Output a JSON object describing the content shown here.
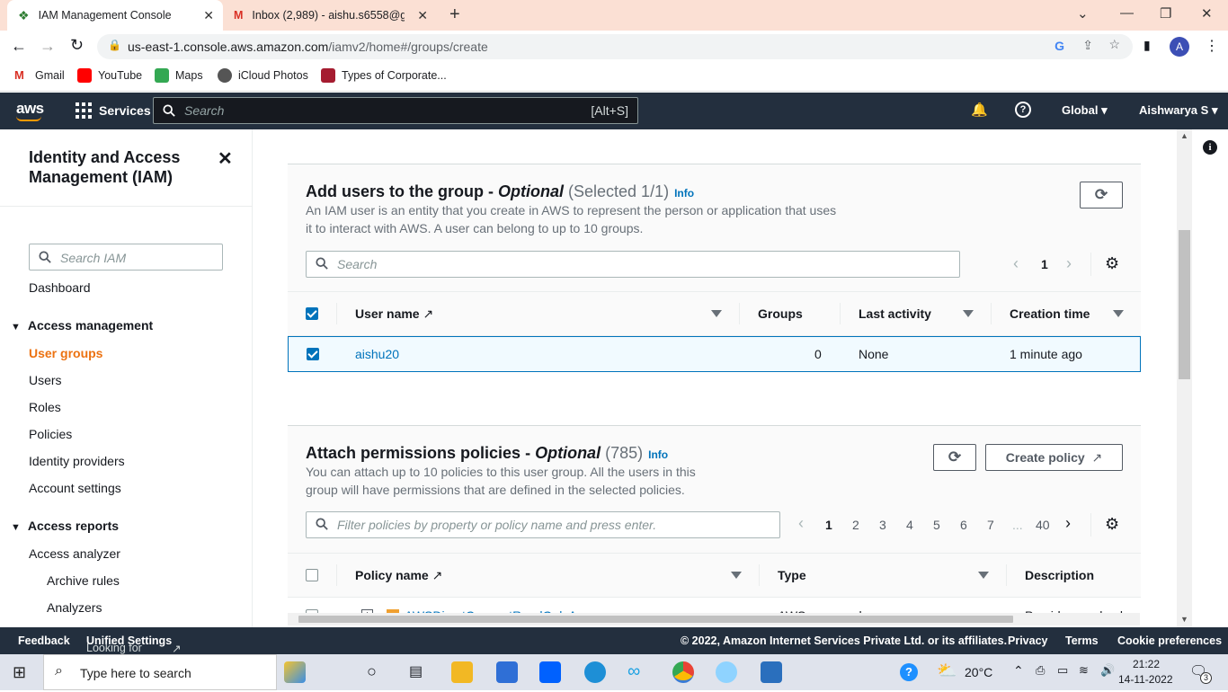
{
  "browser": {
    "tabs": [
      {
        "title": "IAM Management Console",
        "active": true
      },
      {
        "title": "Inbox (2,989) - aishu.s6558@gma",
        "active": false
      }
    ],
    "url_host": "us-east-1.console.aws.amazon.com",
    "url_path": "/iamv2/home#/groups/create",
    "profile_initial": "A",
    "bookmarks": [
      "Gmail",
      "YouTube",
      "Maps",
      "iCloud Photos",
      "Types of Corporate..."
    ]
  },
  "aws_header": {
    "logo": "aws",
    "services": "Services",
    "search_placeholder": "Search",
    "search_shortcut": "[Alt+S]",
    "region": "Global",
    "user": "Aishwarya S"
  },
  "sidebar": {
    "title": "Identity and Access Management (IAM)",
    "search_placeholder": "Search IAM",
    "dashboard": "Dashboard",
    "access_management": "Access management",
    "am_items": [
      "User groups",
      "Users",
      "Roles",
      "Policies",
      "Identity providers",
      "Account settings"
    ],
    "access_reports": "Access reports",
    "ar_items": [
      "Access analyzer"
    ],
    "ar_subitems": [
      "Archive rules",
      "Analyzers"
    ]
  },
  "add_users": {
    "title": "Add users to the group",
    "sep": " - ",
    "optional": "Optional",
    "count": "(Selected 1/1)",
    "info": "Info",
    "description": "An IAM user is an entity that you create in AWS to represent the person or application that uses it to interact with AWS. A user can belong to up to 10 groups.",
    "search_placeholder": "Search",
    "page": "1",
    "columns": [
      "User name",
      "Groups",
      "Last activity",
      "Creation time"
    ],
    "rows": [
      {
        "user_name": "aishu20",
        "groups": "0",
        "last_activity": "None",
        "creation_time": "1 minute ago",
        "selected": true
      }
    ]
  },
  "attach_policies": {
    "title": "Attach permissions policies",
    "sep": " - ",
    "optional": "Optional",
    "count": "(785)",
    "info": "Info",
    "description": "You can attach up to 10 policies to this user group. All the users in this group will have permissions that are defined in the selected policies.",
    "create_policy": "Create policy",
    "filter_placeholder": "Filter policies by property or policy name and press enter.",
    "pages": [
      "1",
      "2",
      "3",
      "4",
      "5",
      "6",
      "7",
      "...",
      "40"
    ],
    "current_page": "1",
    "columns": [
      "Policy name",
      "Type",
      "Description"
    ],
    "partial_row": {
      "name": "AWSDirectConnectReadOnlyAccess",
      "type": "AWS managed",
      "description": "Provides read only a"
    }
  },
  "footer": {
    "feedback": "Feedback",
    "lang_prompt": "Looking for language selection? Find it in the new",
    "unified": "Unified Settings",
    "copyright": "© 2022, Amazon Internet Services Private Ltd. or its affiliates.",
    "privacy": "Privacy",
    "terms": "Terms",
    "cookies": "Cookie preferences"
  },
  "taskbar": {
    "search_placeholder": "Type here to search",
    "weather": "20°C",
    "time": "21:22",
    "date": "14-11-2022",
    "notifications": "3"
  },
  "colors": {
    "aws_nav": "#232f3e",
    "accent_orange": "#ec7211",
    "link_blue": "#0073bb"
  }
}
